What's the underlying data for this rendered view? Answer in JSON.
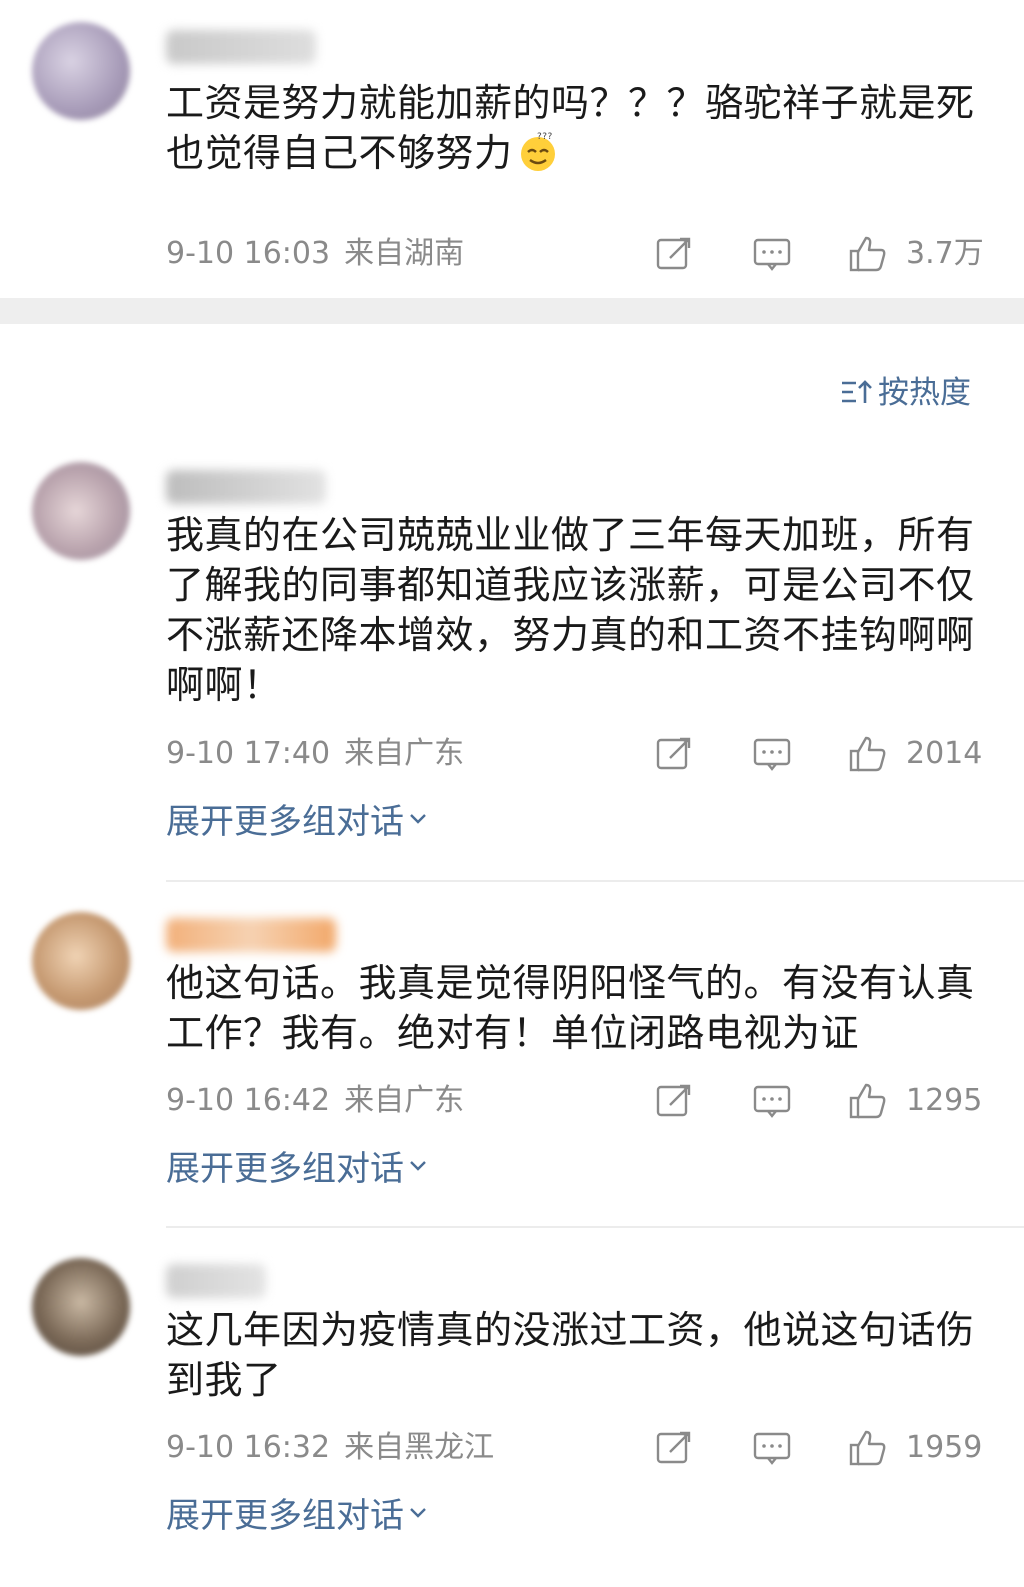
{
  "sort": {
    "label": "按热度"
  },
  "comments": [
    {
      "text_line1": "工资是努力就能加薪的吗？？？骆驼祥子就是死",
      "text_line2": "也觉得自己不够努力",
      "time": "9-10 16:03",
      "location": "来自湖南",
      "likes": "3.7万"
    },
    {
      "text": "我真的在公司兢兢业业做了三年每天加班，所有了解我的同事都知道我应该涨薪，可是公司不仅不涨薪还降本增效，努力真的和工资不挂钩啊啊啊啊！",
      "time": "9-10 17:40",
      "location": "来自广东",
      "likes": "2014",
      "expand": "展开更多组对话"
    },
    {
      "text": "他这句话。我真是觉得阴阳怪气的。有没有认真工作？我有。绝对有！单位闭路电视为证",
      "time": "9-10 16:42",
      "location": "来自广东",
      "likes": "1295",
      "expand": "展开更多组对话"
    },
    {
      "text": "这几年因为疫情真的没涨过工资，他说这句话伤到我了",
      "time": "9-10 16:32",
      "location": "来自黑龙江",
      "likes": "1959",
      "expand": "展开更多组对话"
    }
  ],
  "colors": {
    "link": "#4a6d96",
    "meta": "#8a8a8a",
    "text": "#1a1a1a",
    "gap": "#eeeeee"
  }
}
